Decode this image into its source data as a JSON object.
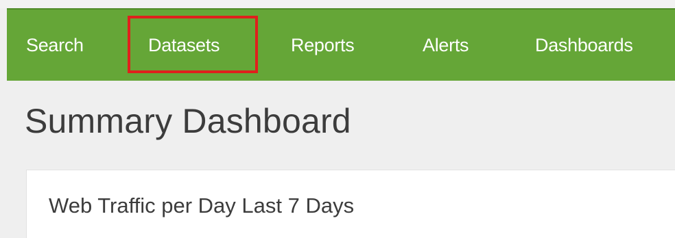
{
  "nav": {
    "items": [
      {
        "label": "Search"
      },
      {
        "label": "Datasets"
      },
      {
        "label": "Reports"
      },
      {
        "label": "Alerts"
      },
      {
        "label": "Dashboards"
      }
    ],
    "highlighted": "Datasets"
  },
  "page": {
    "title": "Summary Dashboard"
  },
  "panel": {
    "title": "Web Traffic per Day Last 7 Days"
  },
  "colors": {
    "nav_background": "#65a637",
    "highlight_border": "#e0201c",
    "page_background": "#efefef"
  }
}
